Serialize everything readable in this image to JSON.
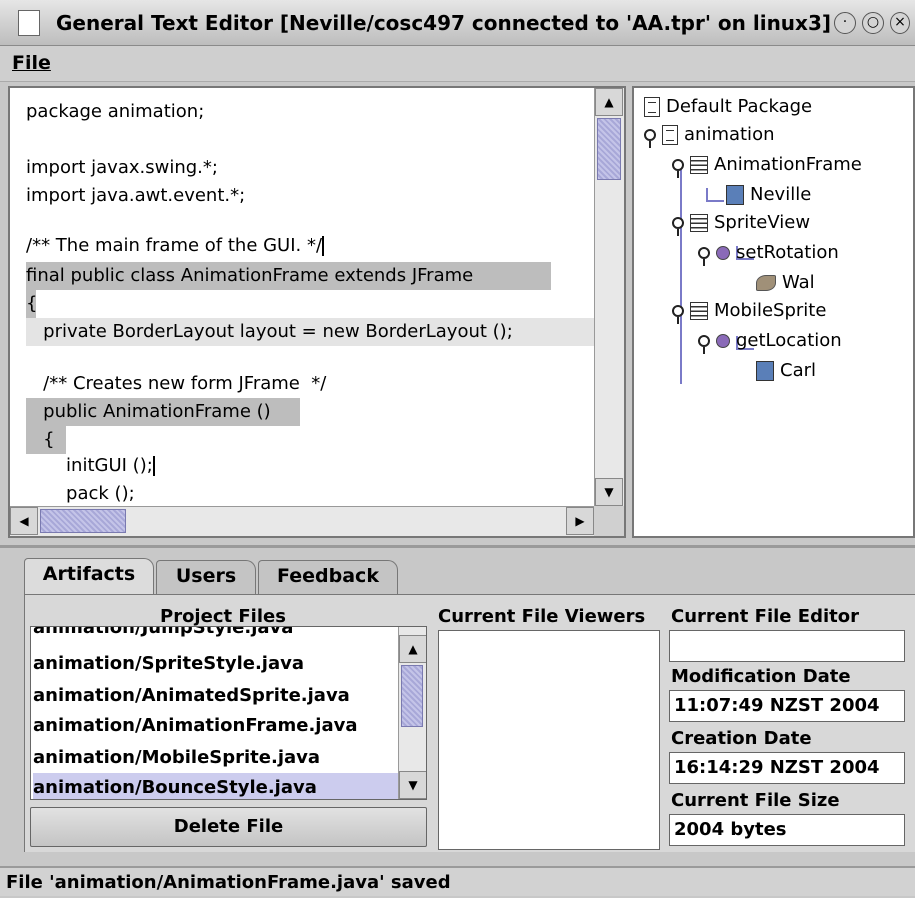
{
  "window": {
    "title": "General Text Editor [Neville/cosc497 connected to 'AA.tpr' on linux3]"
  },
  "menu": {
    "file_label": "File"
  },
  "editor": {
    "lines": [
      "package animation;",
      "",
      "import javax.swing.*;",
      "import java.awt.event.*;",
      "",
      "/** The main frame of the GUI. */",
      "final public class AnimationFrame extends JFrame",
      "{",
      "   private BorderLayout layout = new BorderLayout ();",
      "",
      "   /** Creates new form JFrame  */",
      "   public AnimationFrame ()",
      "   {",
      "       initGUI ();",
      "       pack ();"
    ]
  },
  "tree": {
    "nodes": [
      "Default Package",
      "animation",
      "AnimationFrame",
      "Neville",
      "SpriteView",
      "setRotation",
      "Wal",
      "MobileSprite",
      "getLocation",
      "Carl"
    ]
  },
  "tabs": [
    "Artifacts",
    "Users",
    "Feedback"
  ],
  "artifacts": {
    "project_files_header": "Project Files",
    "files": [
      "animation/JumpStyle.java",
      "animation/SpriteStyle.java",
      "animation/AnimatedSprite.java",
      "animation/AnimationFrame.java",
      "animation/MobileSprite.java",
      "animation/BounceStyle.java"
    ],
    "selected_file": "animation/BounceStyle.java",
    "delete_button": "Delete File",
    "viewers_header": "Current File Viewers",
    "editor_header": "Current File Editor",
    "editor_value": "",
    "modification_label": "Modification Date",
    "modification_value": "11:07:49 NZST 2004",
    "creation_label": "Creation Date",
    "creation_value": "16:14:29 NZST 2004",
    "size_label": "Current File Size",
    "size_value": "2004 bytes"
  },
  "status": {
    "text": "File 'animation/AnimationFrame.java' saved"
  }
}
